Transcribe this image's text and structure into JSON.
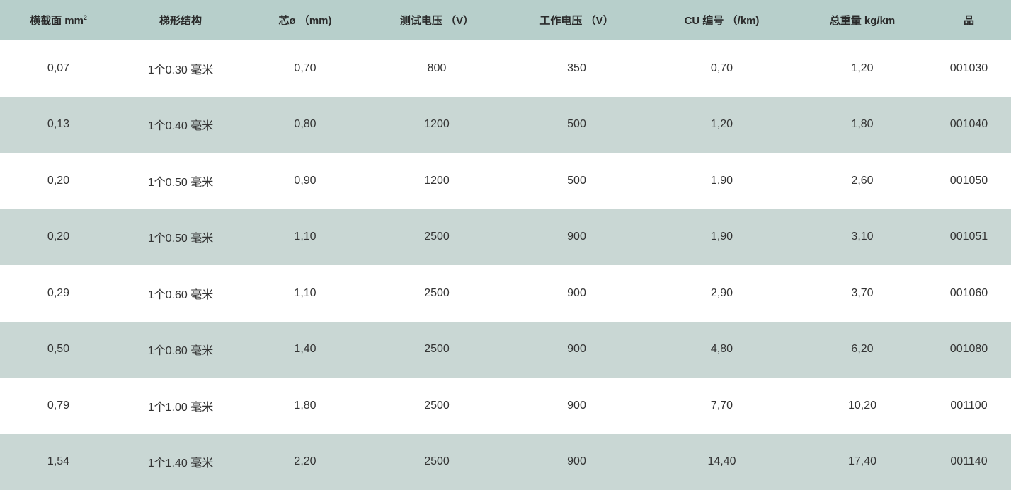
{
  "table": {
    "headers": [
      {
        "label": "横截面 mm",
        "sup": "2"
      },
      {
        "label": "梯形结构"
      },
      {
        "label": "芯ø （mm)"
      },
      {
        "label": "测试电压 （V）"
      },
      {
        "label": "工作电压 （V）"
      },
      {
        "label": "CU 编号 （/km)"
      },
      {
        "label": "总重量 kg/km"
      },
      {
        "label": "品"
      }
    ],
    "rows": [
      [
        "0,07",
        "1个0.30 毫米",
        "0,70",
        "800",
        "350",
        "0,70",
        "1,20",
        "001030"
      ],
      [
        "0,13",
        "1个0.40 毫米",
        "0,80",
        "1200",
        "500",
        "1,20",
        "1,80",
        "001040"
      ],
      [
        "0,20",
        "1个0.50 毫米",
        "0,90",
        "1200",
        "500",
        "1,90",
        "2,60",
        "001050"
      ],
      [
        "0,20",
        "1个0.50 毫米",
        "1,10",
        "2500",
        "900",
        "1,90",
        "3,10",
        "001051"
      ],
      [
        "0,29",
        "1个0.60 毫米",
        "1,10",
        "2500",
        "900",
        "2,90",
        "3,70",
        "001060"
      ],
      [
        "0,50",
        "1个0.80 毫米",
        "1,40",
        "2500",
        "900",
        "4,80",
        "6,20",
        "001080"
      ],
      [
        "0,79",
        "1个1.00 毫米",
        "1,80",
        "2500",
        "900",
        "7,70",
        "10,20",
        "001100"
      ],
      [
        "1,54",
        "1个1.40 毫米",
        "2,20",
        "2500",
        "900",
        "14,40",
        "17,40",
        "001140"
      ]
    ]
  },
  "colors": {
    "header_bg": "#b7cfcb",
    "row_even_bg": "#c9d7d4",
    "row_odd_bg": "#ffffff"
  }
}
